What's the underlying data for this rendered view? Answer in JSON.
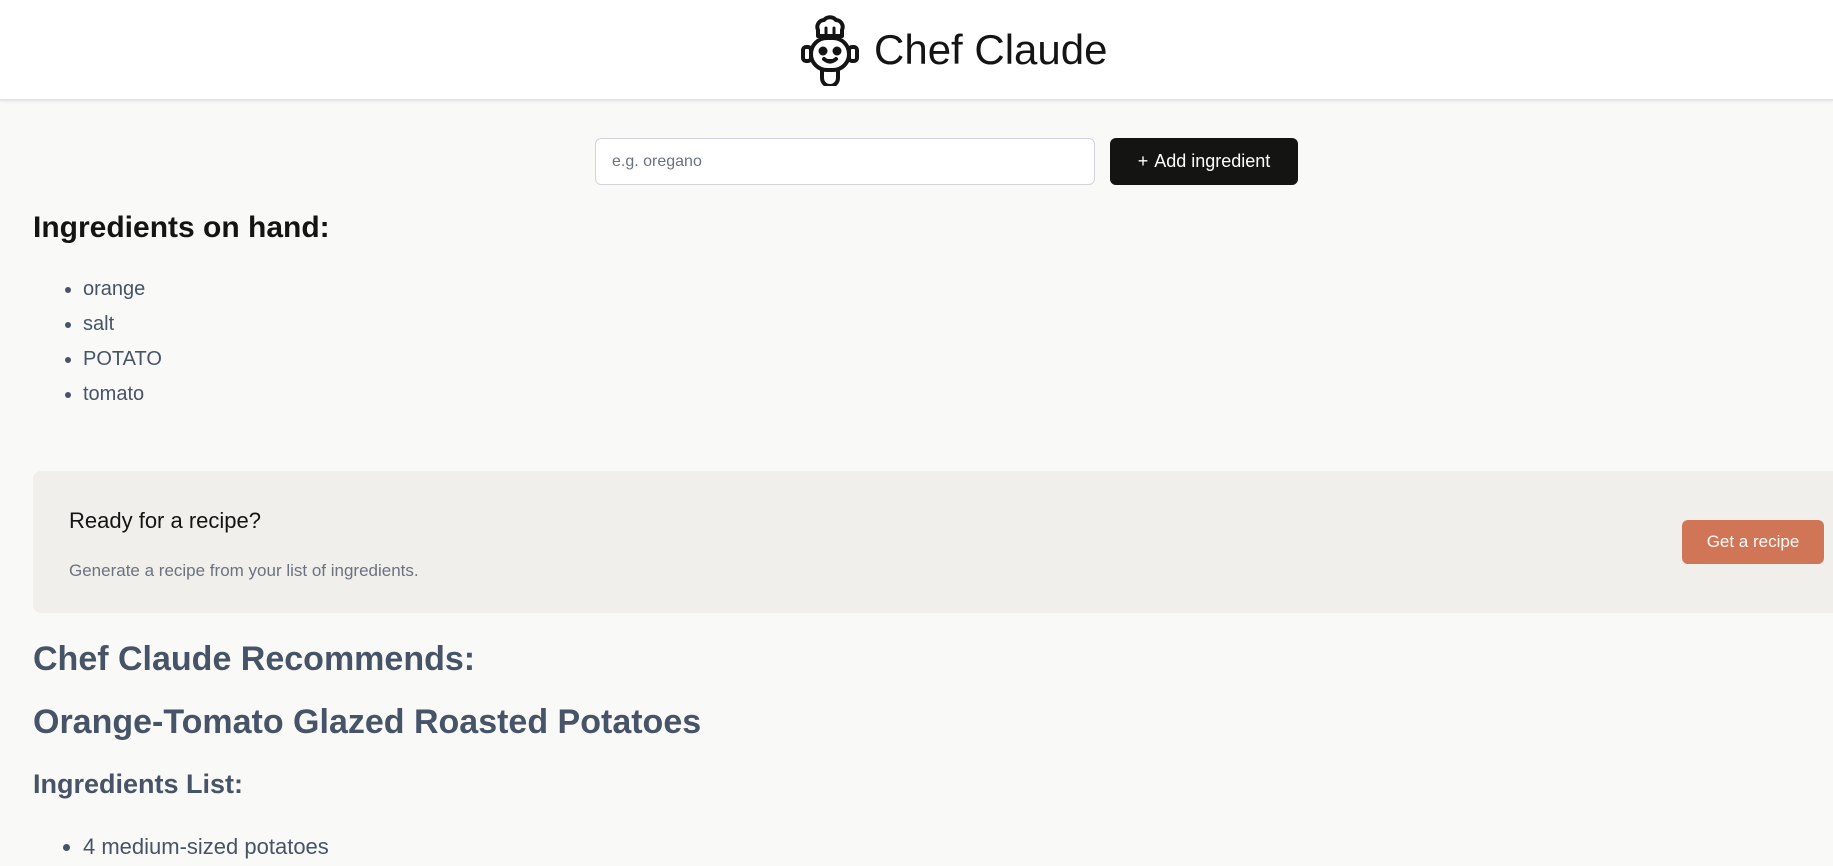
{
  "header": {
    "logo_icon": "chef-robot-icon",
    "title": "Chef Claude"
  },
  "form": {
    "placeholder": "e.g. oregano",
    "value": "",
    "add_button_icon": "+",
    "add_button_label": "Add ingredient"
  },
  "ingredients": {
    "heading": "Ingredients on hand:",
    "items": [
      "orange",
      "salt",
      "POTATO",
      "tomato"
    ]
  },
  "cta": {
    "title": "Ready for a recipe?",
    "subtitle": "Generate a recipe from your list of ingredients.",
    "button_label": "Get a recipe",
    "button_color": "#d17557"
  },
  "recommendation": {
    "heading": "Chef Claude Recommends:",
    "recipe_title": "Orange-Tomato Glazed Roasted Potatoes",
    "ingredients_heading": "Ingredients List:",
    "ingredients": [
      "4 medium-sized potatoes"
    ]
  },
  "colors": {
    "header_bg": "#ffffff",
    "page_bg": "#f9f9f7",
    "primary_button": "#141413",
    "accent": "#d17557",
    "muted_text": "#475467"
  }
}
